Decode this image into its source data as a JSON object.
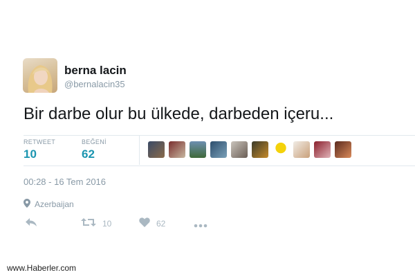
{
  "user": {
    "display_name": "berna lacin",
    "handle": "@bernalacin35"
  },
  "tweet": {
    "text": "Bir darbe olur bu ülkede, darbeden içeru..."
  },
  "stats": {
    "retweet_label": "RETWEET",
    "retweet_count": "10",
    "like_label": "BEĞENİ",
    "like_count": "62"
  },
  "likers": [
    "liker-1",
    "liker-2",
    "liker-3",
    "liker-4",
    "liker-5",
    "liker-6",
    "liker-7",
    "liker-8",
    "liker-9",
    "liker-10"
  ],
  "timestamp": "00:28 - 16 Tem 2016",
  "location": {
    "icon": "location-pin-icon",
    "name": "Azerbaijan"
  },
  "actions": {
    "reply_icon": "reply-icon",
    "retweet_icon": "retweet-icon",
    "retweet_count": "10",
    "like_icon": "heart-icon",
    "like_count": "62",
    "more_icon": "more-dots-icon"
  },
  "watermark": "www.Haberler.com",
  "colors": {
    "accent": "#1b95b0",
    "muted": "#8899a6",
    "text": "#14171a"
  }
}
